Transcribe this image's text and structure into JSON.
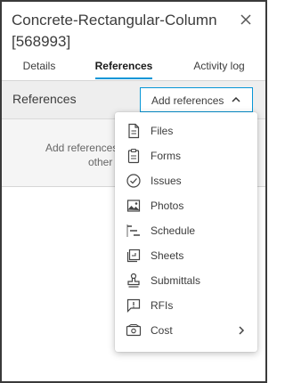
{
  "panel": {
    "title": "Concrete-Rectangular-Column [568993]"
  },
  "tabs": [
    {
      "label": "Details"
    },
    {
      "label": "References"
    },
    {
      "label": "Activity log"
    }
  ],
  "references": {
    "heading": "References",
    "add_button_label": "Add references",
    "empty_text": "Add references to issues, photos and other project items."
  },
  "menu": {
    "items": [
      {
        "label": "Files",
        "icon": "file-icon"
      },
      {
        "label": "Forms",
        "icon": "clipboard-icon"
      },
      {
        "label": "Issues",
        "icon": "check-circle-icon"
      },
      {
        "label": "Photos",
        "icon": "image-icon"
      },
      {
        "label": "Schedule",
        "icon": "schedule-icon"
      },
      {
        "label": "Sheets",
        "icon": "sheets-icon"
      },
      {
        "label": "Submittals",
        "icon": "stamp-icon"
      },
      {
        "label": "RFIs",
        "icon": "rfi-icon"
      },
      {
        "label": "Cost",
        "icon": "cost-icon"
      }
    ]
  },
  "colors": {
    "accent": "#0696d7",
    "text": "#3c3c3c",
    "border": "#3a3a3a"
  }
}
